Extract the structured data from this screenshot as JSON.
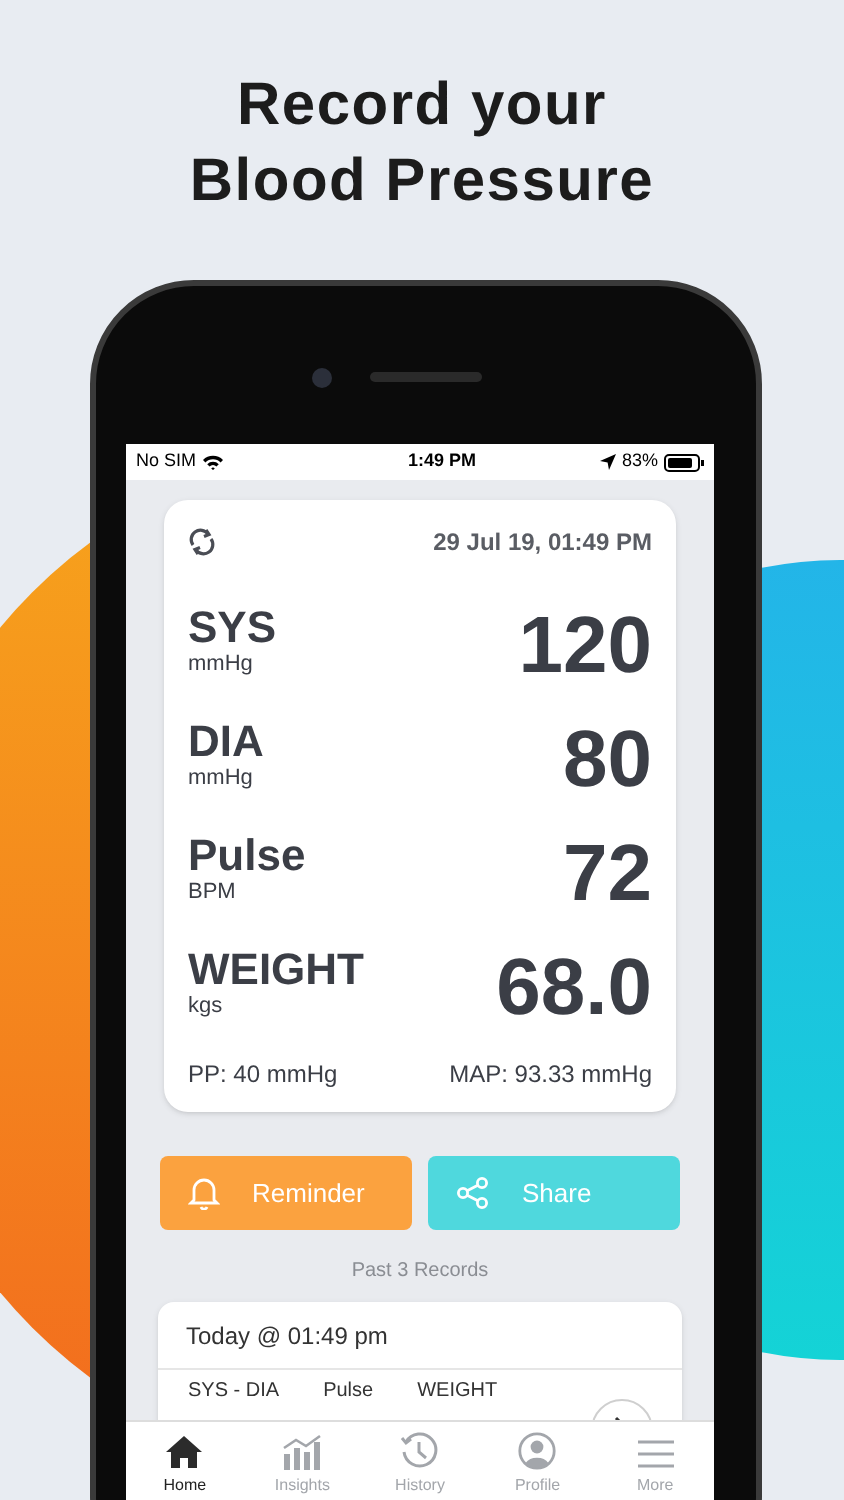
{
  "headline_lines": [
    "Record your",
    "Blood Pressure"
  ],
  "status_bar": {
    "carrier": "No SIM",
    "time": "1:49 PM",
    "battery": "83%"
  },
  "reading": {
    "timestamp": "29 Jul 19, 01:49 PM",
    "metrics": [
      {
        "label": "SYS",
        "unit": "mmHg",
        "value": "120"
      },
      {
        "label": "DIA",
        "unit": "mmHg",
        "value": "80"
      },
      {
        "label": "Pulse",
        "unit": "BPM",
        "value": "72"
      },
      {
        "label": "WEIGHT",
        "unit": "kgs",
        "value": "68.0"
      }
    ],
    "pp": "PP: 40 mmHg",
    "map": "MAP: 93.33 mmHg"
  },
  "actions": [
    {
      "kind": "reminder",
      "label": "Reminder"
    },
    {
      "kind": "share",
      "label": "Share"
    }
  ],
  "records": {
    "title": "Past 3 Records",
    "entries": [
      {
        "title": "Today @ 01:49 pm",
        "columns": [
          "SYS - DIA",
          "Pulse",
          "WEIGHT"
        ]
      }
    ]
  },
  "tabs": [
    {
      "kind": "home",
      "label": "Home",
      "selected": true
    },
    {
      "kind": "insights",
      "label": "Insights",
      "selected": false
    },
    {
      "kind": "history",
      "label": "History",
      "selected": false
    },
    {
      "kind": "profile",
      "label": "Profile",
      "selected": false
    },
    {
      "kind": "more",
      "label": "More",
      "selected": false
    }
  ]
}
